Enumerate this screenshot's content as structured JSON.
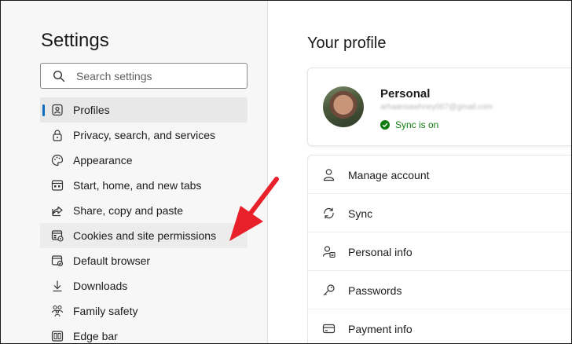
{
  "left": {
    "title": "Settings",
    "search_placeholder": "Search settings",
    "items": [
      {
        "label": "Profiles",
        "icon": "profiles-icon",
        "active": true
      },
      {
        "label": "Privacy, search, and services",
        "icon": "lock-icon"
      },
      {
        "label": "Appearance",
        "icon": "palette-icon"
      },
      {
        "label": "Start, home, and new tabs",
        "icon": "start-tabs-icon"
      },
      {
        "label": "Share, copy and paste",
        "icon": "share-icon"
      },
      {
        "label": "Cookies and site permissions",
        "icon": "cookies-icon",
        "highlighted": true
      },
      {
        "label": "Default browser",
        "icon": "browser-icon"
      },
      {
        "label": "Downloads",
        "icon": "download-icon"
      },
      {
        "label": "Family safety",
        "icon": "family-icon"
      },
      {
        "label": "Edge bar",
        "icon": "edge-bar-icon"
      }
    ]
  },
  "right": {
    "heading": "Your profile",
    "profile": {
      "name": "Personal",
      "email": "arhaansawhney007@gmail.com",
      "sync_status": "Sync is on"
    },
    "menu": [
      {
        "label": "Manage account",
        "icon": "person-icon"
      },
      {
        "label": "Sync",
        "icon": "sync-icon"
      },
      {
        "label": "Personal info",
        "icon": "personal-info-icon"
      },
      {
        "label": "Passwords",
        "icon": "key-icon"
      },
      {
        "label": "Payment info",
        "icon": "card-icon"
      }
    ]
  },
  "colors": {
    "accent": "#0f6cbd",
    "sync_green": "#107c10",
    "annotation_arrow": "#e8202a"
  }
}
